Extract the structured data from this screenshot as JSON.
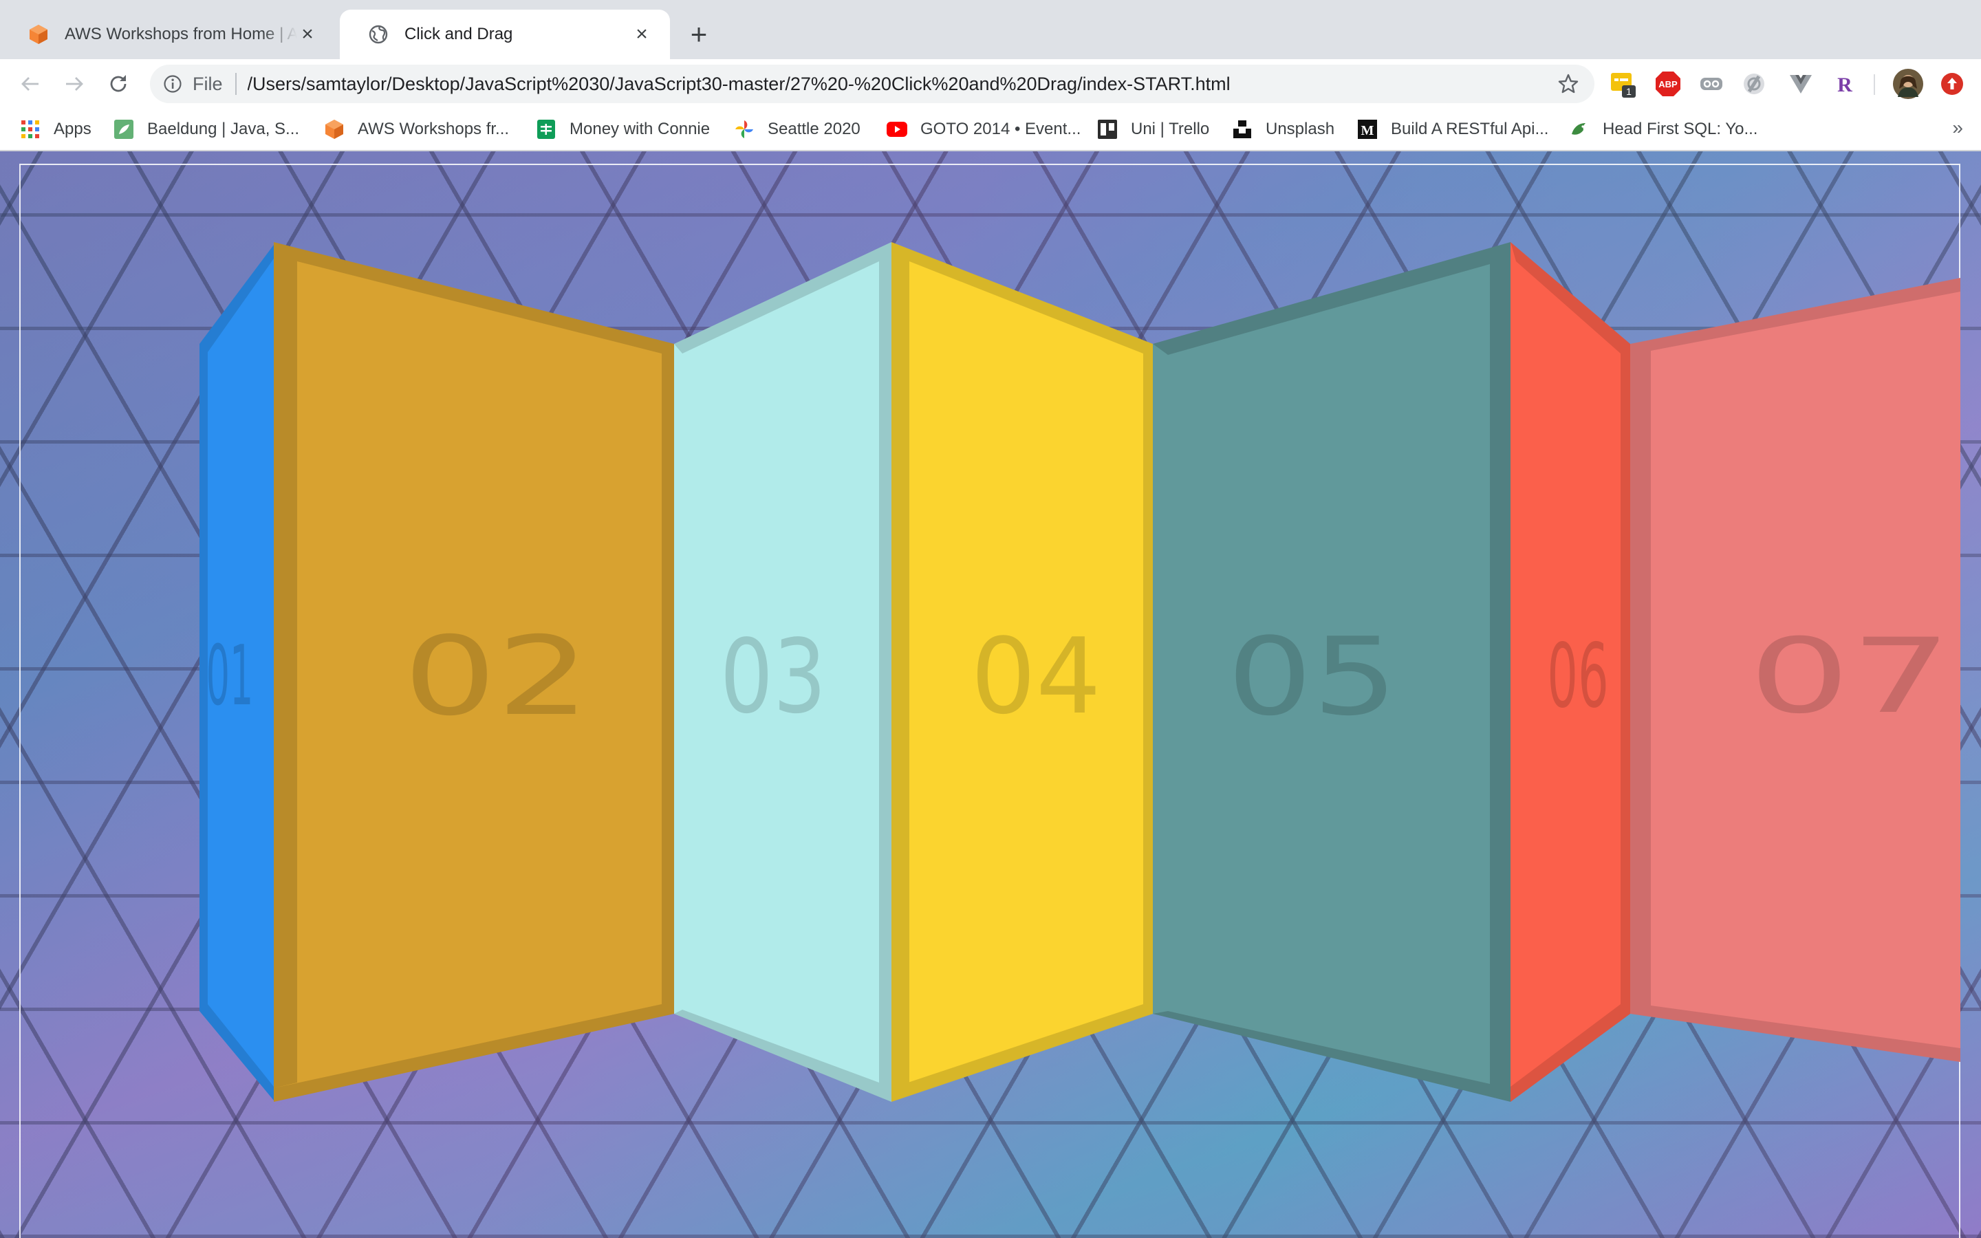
{
  "browser": {
    "tabs": [
      {
        "title": "AWS Workshops from Home | AWS",
        "icon": "aws-cube-icon",
        "active": false
      },
      {
        "title": "Click and Drag",
        "icon": "globe-icon",
        "active": true
      }
    ],
    "address_bar": {
      "scheme_label": "File",
      "url": "/Users/samtaylor/Desktop/JavaScript%2030/JavaScript30-master/27%20-%20Click%20and%20Drag/index-START.html"
    },
    "extensions": [
      {
        "name": "notes-extension-icon",
        "badge": "1"
      },
      {
        "name": "adblock-plus-icon",
        "text": "ABP"
      },
      {
        "name": "link-extension-icon"
      },
      {
        "name": "privacy-extension-icon"
      },
      {
        "name": "vue-devtools-icon"
      },
      {
        "name": "r-extension-icon",
        "text": "R"
      },
      {
        "name": "profile-avatar-icon"
      },
      {
        "name": "update-icon"
      }
    ],
    "bookmarks": [
      {
        "label": "Apps",
        "icon": "apps-grid-icon"
      },
      {
        "label": "Baeldung | Java, S...",
        "icon": "baeldung-icon"
      },
      {
        "label": "AWS Workshops fr...",
        "icon": "aws-cube-icon"
      },
      {
        "label": "Money with Connie",
        "icon": "sheets-icon"
      },
      {
        "label": "Seattle 2020",
        "icon": "photos-icon"
      },
      {
        "label": "GOTO 2014 • Event...",
        "icon": "youtube-icon"
      },
      {
        "label": "Uni | Trello",
        "icon": "trello-icon"
      },
      {
        "label": "Unsplash",
        "icon": "unsplash-icon"
      },
      {
        "label": "Build A RESTful Api...",
        "icon": "medium-icon"
      },
      {
        "label": "Head First SQL: Yo...",
        "icon": "bird-icon"
      }
    ],
    "bookmarks_overflow": "»"
  },
  "page": {
    "panels": [
      {
        "label": "01",
        "color": "#2b8ff0"
      },
      {
        "label": "02",
        "color": "#d8a230"
      },
      {
        "label": "03",
        "color": "#b1ebea"
      },
      {
        "label": "04",
        "color": "#fbd42f"
      },
      {
        "label": "05",
        "color": "#61999b"
      },
      {
        "label": "06",
        "color": "#fb604b"
      },
      {
        "label": "07",
        "color": "#ec7d7b"
      }
    ]
  }
}
